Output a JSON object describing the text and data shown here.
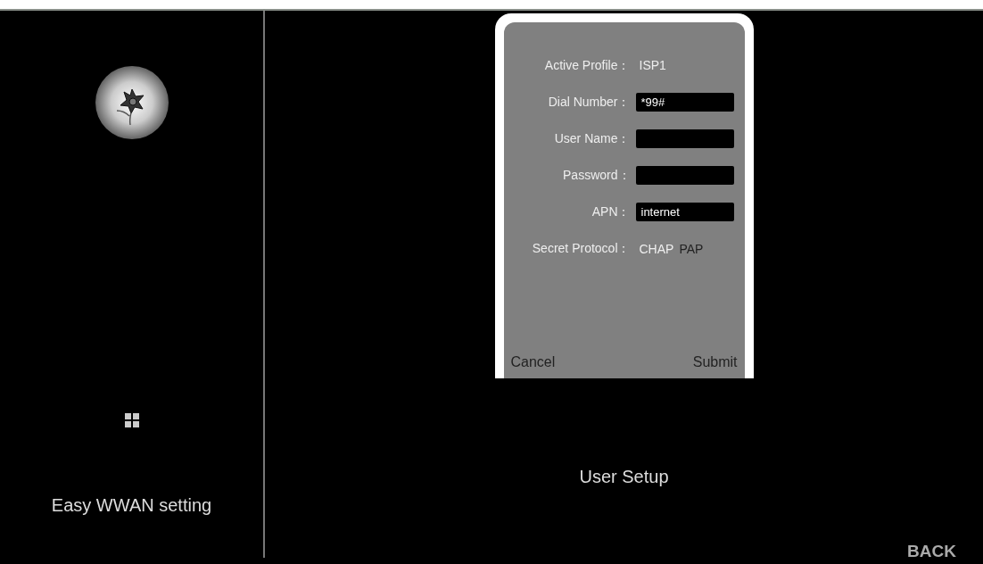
{
  "sidebar": {
    "title": "Easy WWAN setting"
  },
  "dialog": {
    "active_profile": {
      "label": "Active Profile：",
      "value": "ISP1"
    },
    "fields": [
      {
        "label": "Dial Number：",
        "value": "*99#"
      },
      {
        "label": "User Name："
      },
      {
        "label": "Password："
      },
      {
        "label": "APN：",
        "value": "internet"
      }
    ],
    "protocol": {
      "label": "Secret Protocol：",
      "options": [
        {
          "label": "CHAP",
          "selected": true
        },
        {
          "label": "PAP",
          "selected": false
        }
      ]
    },
    "buttons": [
      "Cancel",
      "Submit"
    ]
  },
  "page_title": "User Setup",
  "back": "BACK"
}
